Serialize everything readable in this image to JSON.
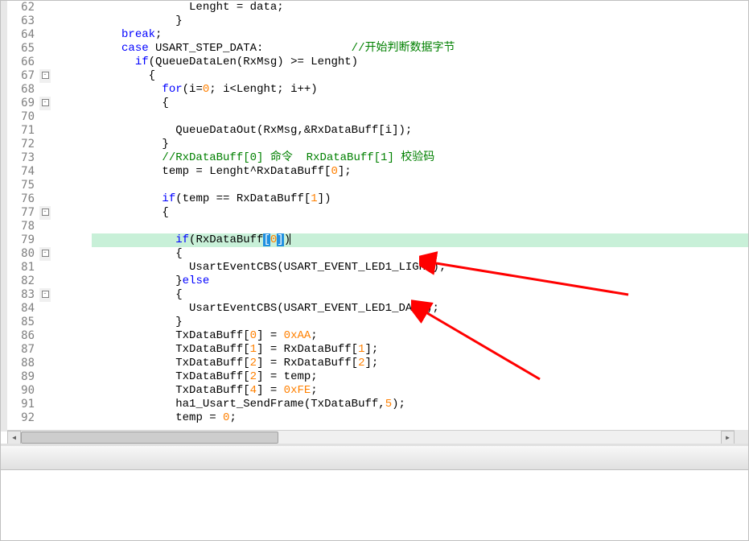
{
  "editor": {
    "highlighted_line": 79,
    "lines": [
      {
        "n": 62,
        "fold": "line",
        "indent": 20,
        "tokens": [
          [
            "ident",
            "Lenght = data;"
          ]
        ]
      },
      {
        "n": 63,
        "fold": "line",
        "indent": 18,
        "tokens": [
          [
            "punct",
            "}"
          ]
        ]
      },
      {
        "n": 64,
        "fold": "line",
        "indent": 10,
        "tokens": [
          [
            "kw",
            "break"
          ],
          [
            "punct",
            ";"
          ]
        ]
      },
      {
        "n": 65,
        "fold": "line",
        "indent": 10,
        "tokens": [
          [
            "kw",
            "case"
          ],
          [
            "ident",
            " USART_STEP_DATA:"
          ],
          [
            "pad",
            "             "
          ],
          [
            "cmt",
            "//开始判断数据字节"
          ]
        ]
      },
      {
        "n": 66,
        "fold": "line",
        "indent": 12,
        "tokens": [
          [
            "kw",
            "if"
          ],
          [
            "punct",
            "(QueueDataLen(RxMsg) >= Lenght)"
          ]
        ]
      },
      {
        "n": 67,
        "fold": "box",
        "indent": 14,
        "tokens": [
          [
            "punct",
            "{"
          ]
        ]
      },
      {
        "n": 68,
        "fold": "line",
        "indent": 16,
        "tokens": [
          [
            "kw",
            "for"
          ],
          [
            "punct",
            "(i="
          ],
          [
            "num",
            "0"
          ],
          [
            "punct",
            "; i<Lenght; i++)"
          ]
        ]
      },
      {
        "n": 69,
        "fold": "box",
        "indent": 16,
        "tokens": [
          [
            "punct",
            "{"
          ]
        ]
      },
      {
        "n": 70,
        "fold": "line",
        "indent": 0,
        "tokens": []
      },
      {
        "n": 71,
        "fold": "line",
        "indent": 18,
        "tokens": [
          [
            "ident",
            "QueueDataOut(RxMsg,&RxDataBuff[i]);"
          ]
        ]
      },
      {
        "n": 72,
        "fold": "line",
        "indent": 16,
        "tokens": [
          [
            "punct",
            "}"
          ]
        ]
      },
      {
        "n": 73,
        "fold": "line",
        "indent": 16,
        "tokens": [
          [
            "cmt",
            "//RxDataBuff[0] 命令  RxDataBuff[1] 校验码"
          ]
        ]
      },
      {
        "n": 74,
        "fold": "line",
        "indent": 16,
        "tokens": [
          [
            "ident",
            "temp = Lenght^RxDataBuff["
          ],
          [
            "num",
            "0"
          ],
          [
            "punct",
            "];"
          ]
        ]
      },
      {
        "n": 75,
        "fold": "line",
        "indent": 0,
        "tokens": []
      },
      {
        "n": 76,
        "fold": "line",
        "indent": 16,
        "tokens": [
          [
            "kw",
            "if"
          ],
          [
            "punct",
            "(temp == RxDataBuff["
          ],
          [
            "num",
            "1"
          ],
          [
            "punct",
            "])"
          ]
        ]
      },
      {
        "n": 77,
        "fold": "box",
        "indent": 16,
        "tokens": [
          [
            "punct",
            "{"
          ]
        ]
      },
      {
        "n": 78,
        "fold": "line",
        "indent": 0,
        "tokens": []
      },
      {
        "n": 79,
        "fold": "line",
        "indent": 18,
        "tokens": [
          [
            "kw",
            "if"
          ],
          [
            "punct",
            "(RxDataBuff"
          ],
          [
            "selbr",
            "["
          ],
          [
            "num",
            "0"
          ],
          [
            "selbr",
            "]"
          ],
          [
            "punct",
            ")"
          ],
          [
            "caret",
            ""
          ]
        ]
      },
      {
        "n": 80,
        "fold": "box",
        "indent": 18,
        "tokens": [
          [
            "punct",
            "{"
          ]
        ]
      },
      {
        "n": 81,
        "fold": "line",
        "indent": 20,
        "tokens": [
          [
            "ident",
            "UsartEventCBS(USART_EVENT_LED1_LIGHT);"
          ]
        ]
      },
      {
        "n": 82,
        "fold": "line",
        "indent": 18,
        "tokens": [
          [
            "punct",
            "}"
          ],
          [
            "kw",
            "else"
          ]
        ]
      },
      {
        "n": 83,
        "fold": "box",
        "indent": 18,
        "tokens": [
          [
            "punct",
            "{"
          ]
        ]
      },
      {
        "n": 84,
        "fold": "line",
        "indent": 20,
        "tokens": [
          [
            "ident",
            "UsartEventCBS(USART_EVENT_LED1_DARK);"
          ]
        ]
      },
      {
        "n": 85,
        "fold": "line",
        "indent": 18,
        "tokens": [
          [
            "punct",
            "}"
          ]
        ]
      },
      {
        "n": 86,
        "fold": "line",
        "indent": 18,
        "tokens": [
          [
            "ident",
            "TxDataBuff["
          ],
          [
            "num",
            "0"
          ],
          [
            "ident",
            "] = "
          ],
          [
            "num",
            "0xAA"
          ],
          [
            "punct",
            ";"
          ]
        ]
      },
      {
        "n": 87,
        "fold": "line",
        "indent": 18,
        "tokens": [
          [
            "ident",
            "TxDataBuff["
          ],
          [
            "num",
            "1"
          ],
          [
            "ident",
            "] = RxDataBuff["
          ],
          [
            "num",
            "1"
          ],
          [
            "punct",
            "];"
          ]
        ]
      },
      {
        "n": 88,
        "fold": "line",
        "indent": 18,
        "tokens": [
          [
            "ident",
            "TxDataBuff["
          ],
          [
            "num",
            "2"
          ],
          [
            "ident",
            "] = RxDataBuff["
          ],
          [
            "num",
            "2"
          ],
          [
            "punct",
            "];"
          ]
        ]
      },
      {
        "n": 89,
        "fold": "line",
        "indent": 18,
        "tokens": [
          [
            "ident",
            "TxDataBuff["
          ],
          [
            "num",
            "2"
          ],
          [
            "ident",
            "] = temp;"
          ]
        ]
      },
      {
        "n": 90,
        "fold": "line",
        "indent": 18,
        "tokens": [
          [
            "ident",
            "TxDataBuff["
          ],
          [
            "num",
            "4"
          ],
          [
            "ident",
            "] = "
          ],
          [
            "num",
            "0xFE"
          ],
          [
            "punct",
            ";"
          ]
        ]
      },
      {
        "n": 91,
        "fold": "line",
        "indent": 18,
        "tokens": [
          [
            "ident",
            "ha1_Usart_SendFrame(TxDataBuff,"
          ],
          [
            "num",
            "5"
          ],
          [
            "punct",
            ");"
          ]
        ]
      },
      {
        "n": 92,
        "fold": "line",
        "indent": 18,
        "tokens": [
          [
            "ident",
            "temp = "
          ],
          [
            "num",
            "0"
          ],
          [
            "punct",
            ";"
          ]
        ]
      }
    ]
  },
  "scrollbar": {
    "left_arrow": "◀",
    "right_arrow": "▶"
  },
  "annotations": {
    "arrow1_target": "UsartEventCBS(USART_EVENT_LED1_LIGHT);",
    "arrow2_target": "UsartEventCBS(USART_EVENT_LED1_DARK);"
  }
}
